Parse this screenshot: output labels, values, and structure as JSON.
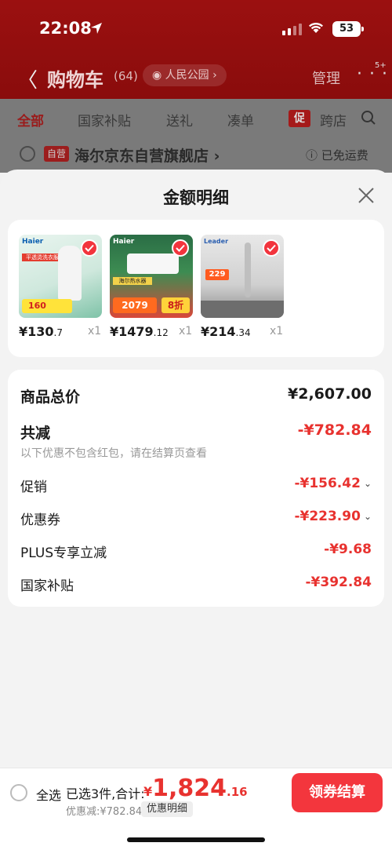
{
  "status_bar": {
    "time": "22:08",
    "battery": "53"
  },
  "header": {
    "back_label": "〈",
    "title": "购物车",
    "count": "(64)",
    "location": "人民公园",
    "manage": "管理",
    "more": "· · ·",
    "more_badge": "5+"
  },
  "tabs": [
    {
      "label": "全部"
    },
    {
      "label": "国家补贴"
    },
    {
      "label": "送礼"
    },
    {
      "label": "凑单"
    },
    {
      "label": "跨店"
    }
  ],
  "promo_badge": "促",
  "store": {
    "badge": "自营",
    "name": "海尔京东自营旗舰店 ›",
    "shipping": "ⓘ 已免运费"
  },
  "sheet": {
    "title": "金额明细",
    "products": [
      {
        "price_main": "¥130",
        "price_dec": ".7",
        "qty": "x1",
        "img_text": "平透烫洗衣服",
        "price_tag": "160"
      },
      {
        "price_main": "¥1479",
        "price_dec": ".12",
        "qty": "x1",
        "img_text": "海尔热水器",
        "price_tag": "2079"
      },
      {
        "price_main": "¥214",
        "price_dec": ".34",
        "qty": "x1",
        "img_text": "Leader",
        "price_tag": "229"
      }
    ],
    "rows": {
      "subtotal_label": "商品总价",
      "subtotal_value": "¥2,607.00",
      "reduce_label": "共减",
      "reduce_value": "-¥782.84",
      "reduce_note": "以下优惠不包含红包，请在结算页查看",
      "promo_label": "促销",
      "promo_value": "-¥156.42",
      "coupon_label": "优惠券",
      "coupon_value": "-¥223.90",
      "plus_label": "PLUS专享立减",
      "plus_value": "-¥9.68",
      "subsidy_label": "国家补贴",
      "subsidy_value": "-¥392.84"
    }
  },
  "bottom": {
    "select_all": "全选",
    "selected_text": "已选3件,合计:",
    "total_currency": "¥",
    "total_int": "1,824",
    "total_dec": ".16",
    "discount_line": "优惠减:¥782.84",
    "detail_label": "优惠明细",
    "checkout_label": "领券结算"
  },
  "colors": {
    "accent": "#f3363d",
    "price_red": "#e8322f",
    "header_bg": "#8a0c0c"
  }
}
